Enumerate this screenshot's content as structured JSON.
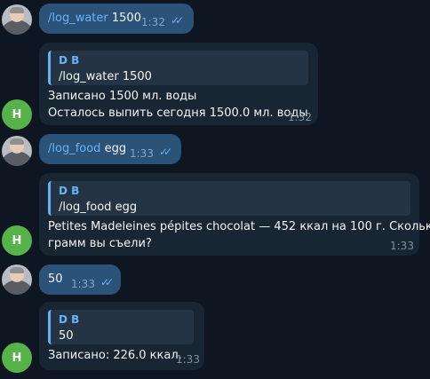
{
  "messages": [
    {
      "command": "/log_water",
      "argument": " 1500",
      "time": "1:32",
      "status_icon": "double-check-icon"
    },
    {
      "reply_author": "D B",
      "reply_text": "/log_water 1500",
      "line1": "Записано 1500 мл. воды",
      "line2": "Осталось выпить сегодня 1500.0 мл. воды",
      "time": "1:32",
      "avatar_letter": "H"
    },
    {
      "command": "/log_food",
      "argument": " egg",
      "time": "1:33",
      "status_icon": "double-check-icon"
    },
    {
      "reply_author": "D B",
      "reply_text": "/log_food egg",
      "line1": "Petites Madeleines pépites chocolat — 452 ккал на 100 г. Сколько",
      "line2": "грамм вы съели?",
      "time": "1:33",
      "avatar_letter": "H"
    },
    {
      "text": "50",
      "time": "1:33",
      "status_icon": "double-check-icon"
    },
    {
      "reply_author": "D B",
      "reply_text": "50",
      "line1": "Записано: 226.0 ккал.",
      "time": "1:33",
      "avatar_letter": "H"
    }
  ]
}
